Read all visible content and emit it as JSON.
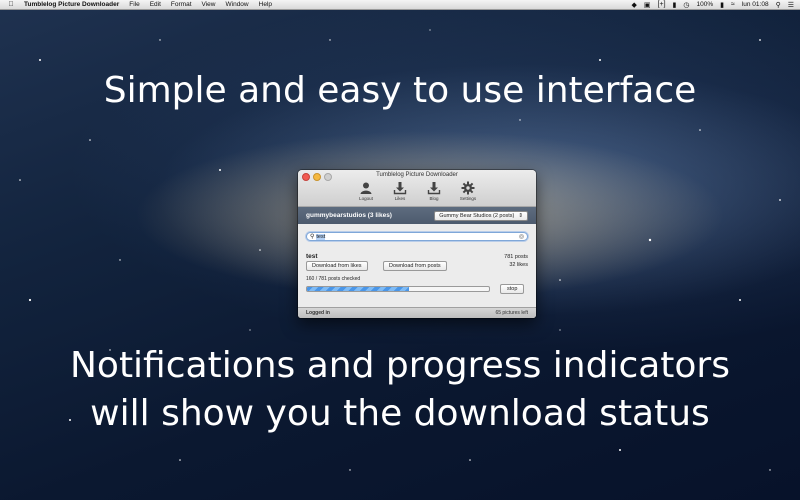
{
  "menubar": {
    "app_name": "Tumblelog Picture Downloader",
    "menus": [
      "File",
      "Edit",
      "Format",
      "View",
      "Window",
      "Help"
    ],
    "battery": "100%",
    "clock": "lun 01:08"
  },
  "headline_top": "Simple and easy to use interface",
  "headline_bottom_1": "Notifications and progress indicators",
  "headline_bottom_2": "will show you the download status",
  "window": {
    "title": "Tumblelog Picture Downloader",
    "toolbar": [
      {
        "label": "Logout",
        "icon": "user-icon"
      },
      {
        "label": "Likes",
        "icon": "download-icon"
      },
      {
        "label": "Blog",
        "icon": "download-icon"
      },
      {
        "label": "Settings",
        "icon": "gear-icon"
      }
    ],
    "user": "gummybearstudios (3 likes)",
    "blog_select": "Gummy Bear Studios (2 posts)",
    "search_value": "test",
    "tag_name": "test",
    "posts_count": "781 posts",
    "likes_count": "32 likes",
    "download_likes_label": "Download from likes",
    "download_posts_label": "Download from posts",
    "progress_label": "160 / 781 posts checked",
    "progress_fraction": 0.56,
    "stop_label": "stop",
    "status_left": "Logged in",
    "status_right": "65 pictures left"
  }
}
